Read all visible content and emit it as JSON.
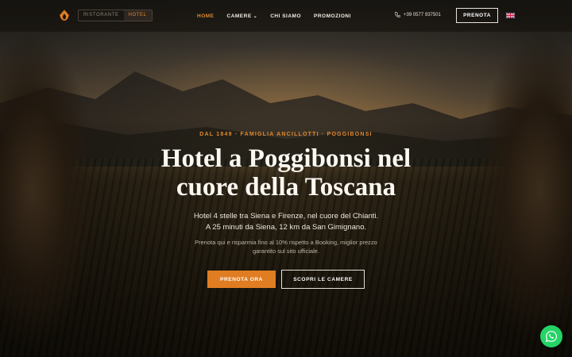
{
  "brand": {
    "logo_icon": "flame-crest-icon",
    "accent": "#e08a2e"
  },
  "segment": {
    "items": [
      {
        "label": "RISTORANTE",
        "active": false
      },
      {
        "label": "HOTEL",
        "active": true
      }
    ]
  },
  "nav": {
    "home": "HOME",
    "rooms": "CAMERE",
    "rooms_caret": "⌄",
    "about": "CHI SIAMO",
    "promos": "PROMOZIONI"
  },
  "contact": {
    "phone_icon": "phone-icon",
    "phone": "+39 0577 937501"
  },
  "header_cta": "PRENOTA",
  "language": {
    "icon": "uk-flag-icon"
  },
  "hero": {
    "eyebrow": "DAL 1849 · FAMIGLIA ANCILLOTTI · POGGIBONSI",
    "title": "Hotel a Poggibonsi nel cuore della Toscana",
    "subtitle_line1": "Hotel 4 stelle tra Siena e Firenze, nel cuore del Chianti.",
    "subtitle_line2": "A 25 minuti da Siena, 12 km da San Gimignano.",
    "note": "Prenota qui e risparmia fino al 10% rispetto a Booking, miglior prezzo garantito sul sito ufficiale.",
    "primary_cta": "PRENOTA ORA",
    "secondary_cta": "SCOPRI LE CAMERE"
  },
  "floating": {
    "whatsapp_icon": "whatsapp-icon",
    "color": "#25d366"
  }
}
